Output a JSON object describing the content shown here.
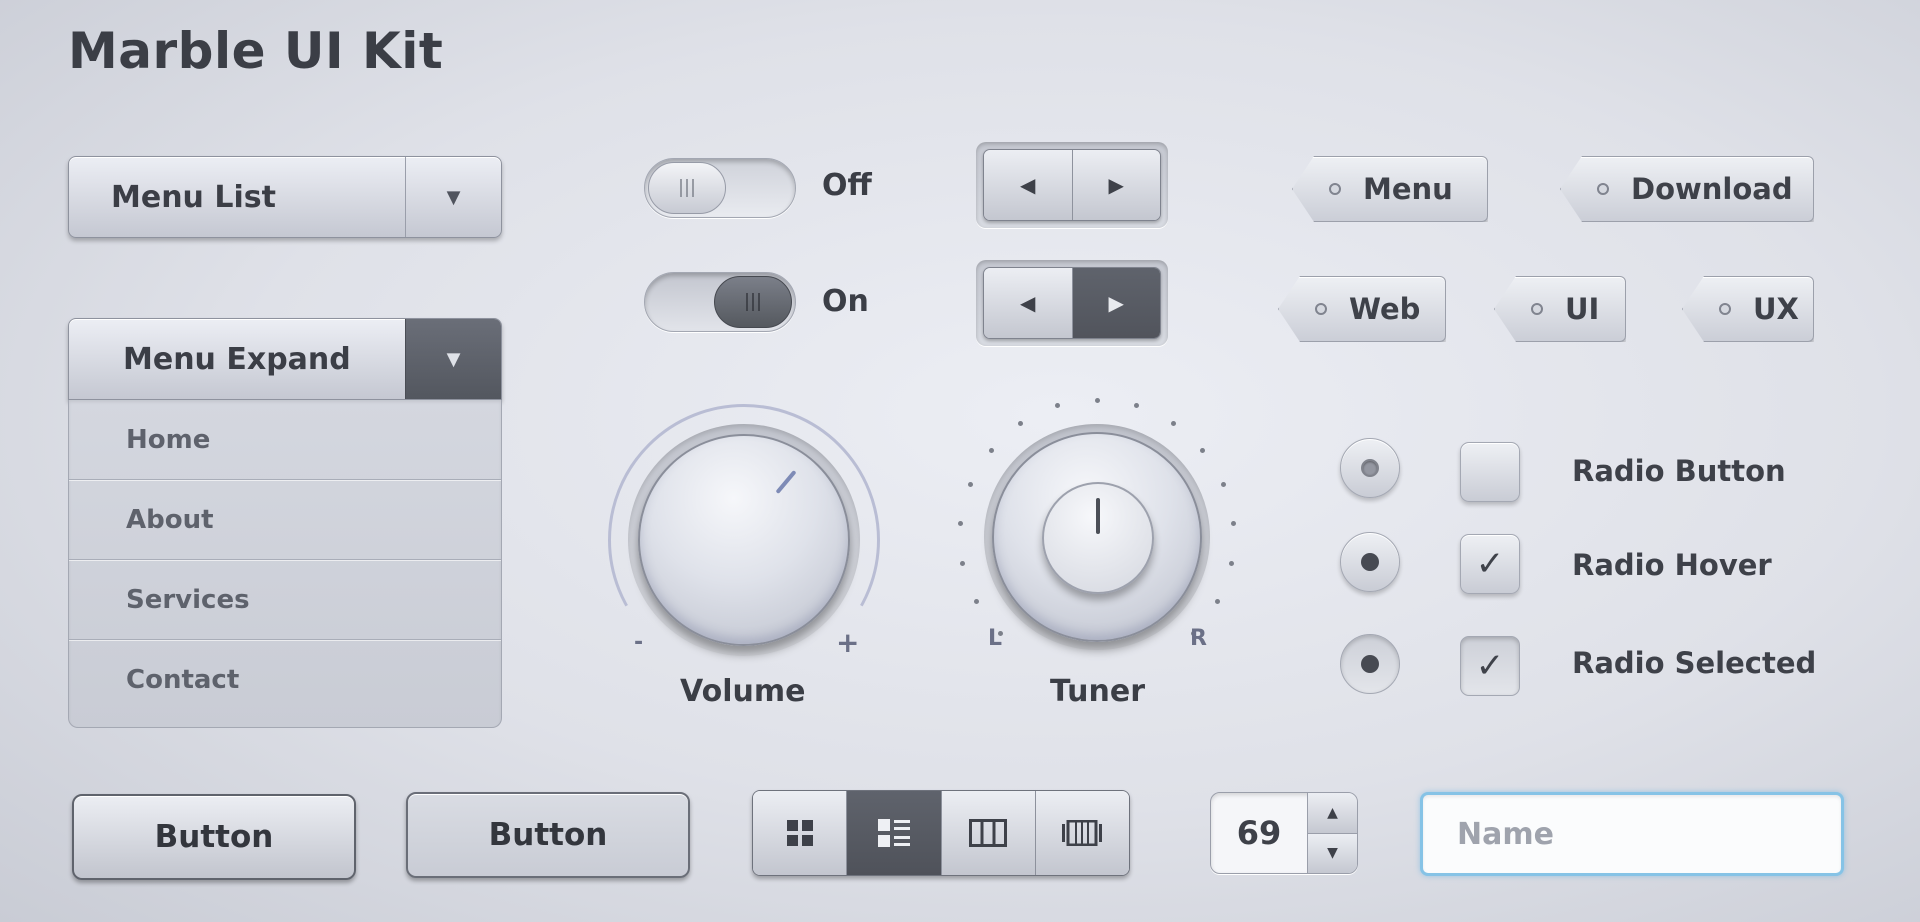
{
  "title": "Marble UI Kit",
  "dropdowns": {
    "list": {
      "label": "Menu List",
      "arrow": "▼"
    },
    "expand": {
      "label": "Menu Expand",
      "arrow": "▼"
    }
  },
  "menu_items": [
    "Home",
    "About",
    "Services",
    "Contact"
  ],
  "toggles": [
    {
      "label": "Off",
      "state": "off"
    },
    {
      "label": "On",
      "state": "on"
    }
  ],
  "arrow_buttons": {
    "prev": "◀",
    "next": "▶"
  },
  "tags": [
    "Menu",
    "Download",
    "Web",
    "UI",
    "UX"
  ],
  "knobs": {
    "volume": {
      "label": "Volume",
      "minus": "-",
      "plus": "+"
    },
    "tuner": {
      "label": "Tuner",
      "left": "L",
      "right": "R"
    }
  },
  "radio_rows": [
    {
      "label": "Radio Button",
      "checked": false
    },
    {
      "label": "Radio Hover",
      "checked": true
    },
    {
      "label": "Radio Selected",
      "checked": true
    }
  ],
  "check_mark": "✓",
  "buttons": [
    "Button",
    "Button"
  ],
  "view_options": [
    "grid-view",
    "list-view",
    "column-view",
    "filmstrip-view"
  ],
  "stepper": {
    "value": "69",
    "up": "▲",
    "down": "▼"
  },
  "name_input": {
    "placeholder": "Name",
    "value": ""
  },
  "colors": {
    "accent_focus": "#86c3e6",
    "active_dark": "#55595f",
    "text": "#3b3e46"
  }
}
